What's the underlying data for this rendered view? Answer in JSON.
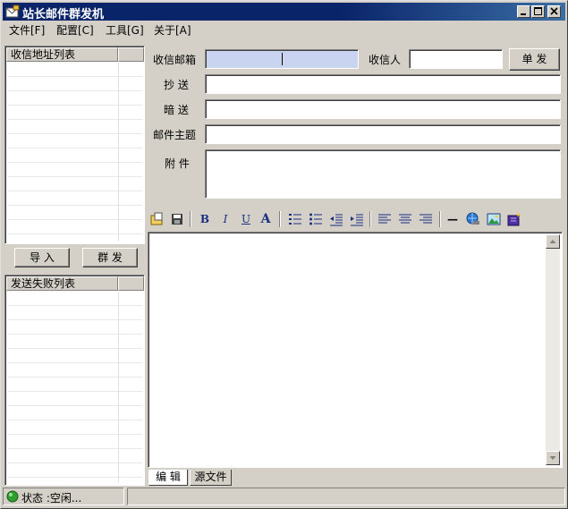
{
  "window": {
    "title": "站长邮件群发机",
    "minimize": "_",
    "maximize": "□",
    "close": "×"
  },
  "menu": {
    "items": [
      {
        "label": "文件[F]"
      },
      {
        "label": "配置[C]"
      },
      {
        "label": "工具[G]"
      },
      {
        "label": "关于[A]"
      }
    ]
  },
  "left_panel": {
    "recipients_header": "收信地址列表",
    "import_button": "导 入",
    "mass_send_button": "群 发",
    "failed_header": "发送失败列表"
  },
  "form": {
    "inbox_label": "收信邮箱",
    "inbox_value": "",
    "recipient_label": "收信人",
    "recipient_value": "",
    "single_send_button": "单 发",
    "cc_label": "抄 送",
    "cc_value": "",
    "bcc_label": "暗 送",
    "bcc_value": "",
    "subject_label": "邮件主题",
    "subject_value": "",
    "attachment_label": "附 件",
    "attachment_value": ""
  },
  "toolbar": {
    "bold": "B",
    "italic": "I",
    "underline": "U",
    "font_color": "A",
    "hr": "—"
  },
  "editor": {
    "content": "",
    "tabs": [
      {
        "label": "编 辑"
      },
      {
        "label": "源文件"
      }
    ]
  },
  "status": {
    "text": "状态 :空闲..."
  },
  "colors": {
    "titlebar": "#0a246a",
    "inbox_focus": "#c8d4f0",
    "status_ok": "#2e9e2e"
  }
}
